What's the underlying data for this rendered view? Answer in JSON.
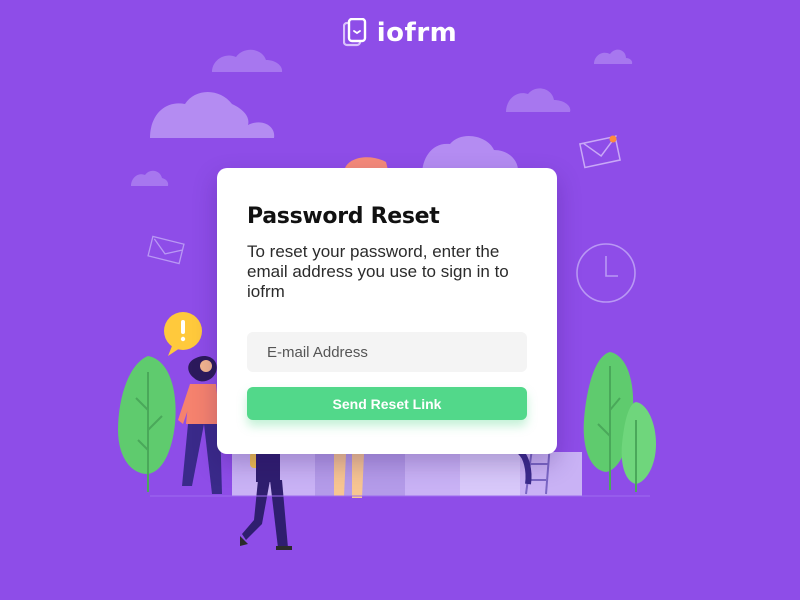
{
  "brand": {
    "name": "iofrm",
    "logo_icon": "iofrm-logo-icon"
  },
  "card": {
    "title": "Password Reset",
    "description": "To reset your password, enter the email address you use to sign in to iofrm",
    "email_placeholder": "E-mail Address",
    "submit_label": "Send Reset Link"
  },
  "colors": {
    "background": "#8e4de8",
    "accent": "#52d88a",
    "card": "#ffffff",
    "cloud": "#b48cf2",
    "tree": "#5fcb6e"
  }
}
